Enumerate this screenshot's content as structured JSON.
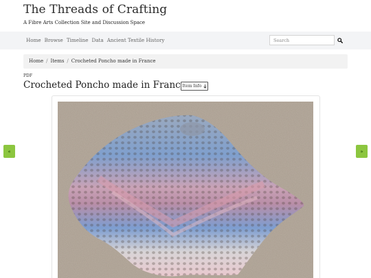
{
  "site": {
    "title": "The Threads of Crafting",
    "tagline": "A Fibre Arts Collection Site and Discussion Space"
  },
  "nav": {
    "items": [
      "Home",
      "Browse",
      "Timeline",
      "Data",
      "Ancient Textile History"
    ]
  },
  "search": {
    "placeholder": "Search",
    "icon": "search-icon"
  },
  "breadcrumb": {
    "items": [
      "Home",
      "Items",
      "Crocheted Poncho made in France"
    ],
    "separator": "/"
  },
  "item": {
    "format_label": "PDF",
    "title": "Crocheted Poncho made in France",
    "info_button_label": "Item Info",
    "info_button_icon": "arrow-down-icon"
  },
  "pager": {
    "prev_label": "«",
    "next_label": "»"
  },
  "colors": {
    "accent_green": "#8cc63f",
    "navbar_bg": "#f3f4f6",
    "breadcrumb_bg": "#f2f2f2"
  }
}
